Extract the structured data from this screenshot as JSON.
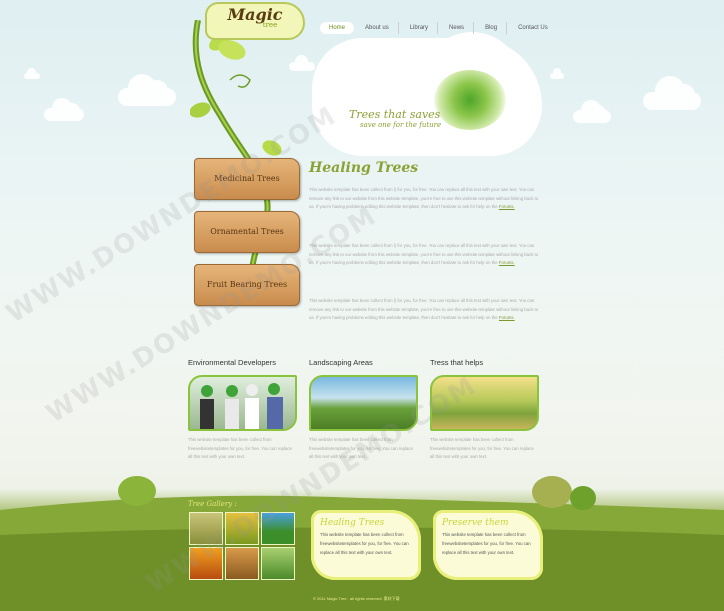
{
  "logo": {
    "line1": "Magic",
    "line2": "tree"
  },
  "nav": [
    "Home",
    "About us",
    "Library",
    "News",
    "Blog",
    "Contact Us"
  ],
  "hero": {
    "slogan_main": "Trees that saves",
    "slogan_sub": "save one for the future"
  },
  "side_boards": [
    "Medicinal Trees",
    "Ornamental Trees",
    "Fruit Bearing Trees"
  ],
  "main": {
    "title": "Healing Trees",
    "paragraphs": [
      "This website template has been collect from § for you, for free. You can replace all this text with your own text. You can remove any link to our website from this website template, you're free to use this website template without linking back to us. If you're having problems editing this website template, then don't hesitate to ask for help on the",
      "This website template has been collect from § for you, for free. You can replace all this text with your own text. You can remove any link to our website from this website template, you're free to use this website template without linking back to us. If you're having problems editing this website template, then don't hesitate to ask for help on the",
      "This website template has been collect from § for you, for free. You can replace all this text with your own text. You can remove any link to our website from this website template, you're free to use this website template without linking back to us. If you're having problems editing this website template, then don't hesitate to ask for help on the"
    ],
    "link_label": "Forums."
  },
  "columns": [
    {
      "title": "Environmental Developers",
      "text": "This website template has been collect from freewebsitetemplates for you, for free. You can replace all this text with your own text."
    },
    {
      "title": "Landscaping Areas",
      "text": "This website template has been collect from freewebsitetemplates for you, for free. You can replace all this text with your own text."
    },
    {
      "title": "Tress that helps",
      "text": "This website template has been collect from freewebsitetemplates for you, for free. You can replace all this text with your own text."
    }
  ],
  "gallery": {
    "title": "Tree Gallery :"
  },
  "notes": [
    {
      "title": "Healing Trees",
      "text": "This website template has been collect from freewebsitetemplates for you, for free. You can replace all this text with your own text."
    },
    {
      "title": "Preserve them",
      "text": "This website template has been collect from freewebsitetemplates for you, for free. You can replace all this text with your own text."
    }
  ],
  "footer": "© 2011 Magic Tree . all rights reserved. 素材下载",
  "watermark": "WWW.DOWNDEMO.COM",
  "colors": {
    "accent": "#8aa233",
    "grass": "#6e8f24",
    "board": "#d59d5e"
  }
}
